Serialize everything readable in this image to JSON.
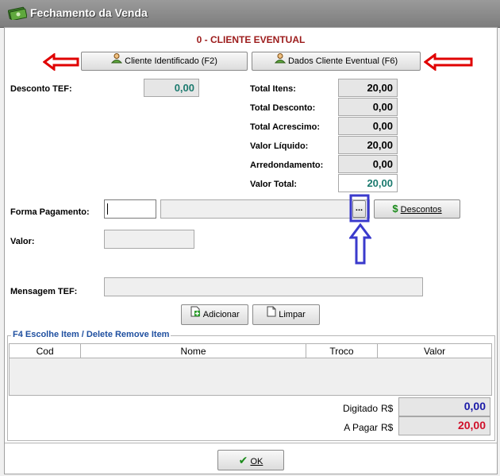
{
  "window": {
    "title": "Fechamento da Venda"
  },
  "client_header": {
    "name": "0 - CLIENTE EVENTUAL"
  },
  "buttons": {
    "cliente_identificado": "Cliente Identificado (F2)",
    "dados_cliente_eventual": "Dados Cliente Eventual (F6)",
    "ellipsis": "...",
    "descontos": "Descontos",
    "adicionar": "Adicionar",
    "limpar": "Limpar",
    "ok": "OK"
  },
  "desconto_tef": {
    "label": "Desconto TEF:",
    "value": "0,00"
  },
  "totals": [
    {
      "label": "Total Itens:",
      "value": "20,00"
    },
    {
      "label": "Total Desconto:",
      "value": "0,00"
    },
    {
      "label": "Total Acrescimo:",
      "value": "0,00"
    },
    {
      "label": "Valor Líquido:",
      "value": "20,00"
    },
    {
      "label": "Arredondamento:",
      "value": "0,00"
    },
    {
      "label": "Valor Total:",
      "value": "20,00"
    }
  ],
  "payment": {
    "forma_label": "Forma Pagamento:",
    "forma_code": "",
    "forma_desc": "",
    "valor_label": "Valor:",
    "valor_value": "",
    "mensagem_label": "Mensagem TEF:",
    "mensagem_value": ""
  },
  "items_group": {
    "title": "F4 Escolhe Item / Delete Remove Item",
    "columns": [
      "Cod",
      "Nome",
      "Troco",
      "Valor"
    ],
    "rows": []
  },
  "summary": {
    "digitado_label": "Digitado",
    "digitado_currency": "R$",
    "digitado_value": "0,00",
    "apagar_label": "A Pagar",
    "apagar_currency": "R$",
    "apagar_value": "20,00"
  },
  "colors": {
    "client_name": "#9c1b1b",
    "valor_total": "#1b7a6e",
    "digitado": "#1a1aa8",
    "apagar": "#d0102a",
    "annotation_red": "#e00000",
    "annotation_blue": "#3a3acc",
    "group_title": "#2050a0"
  }
}
